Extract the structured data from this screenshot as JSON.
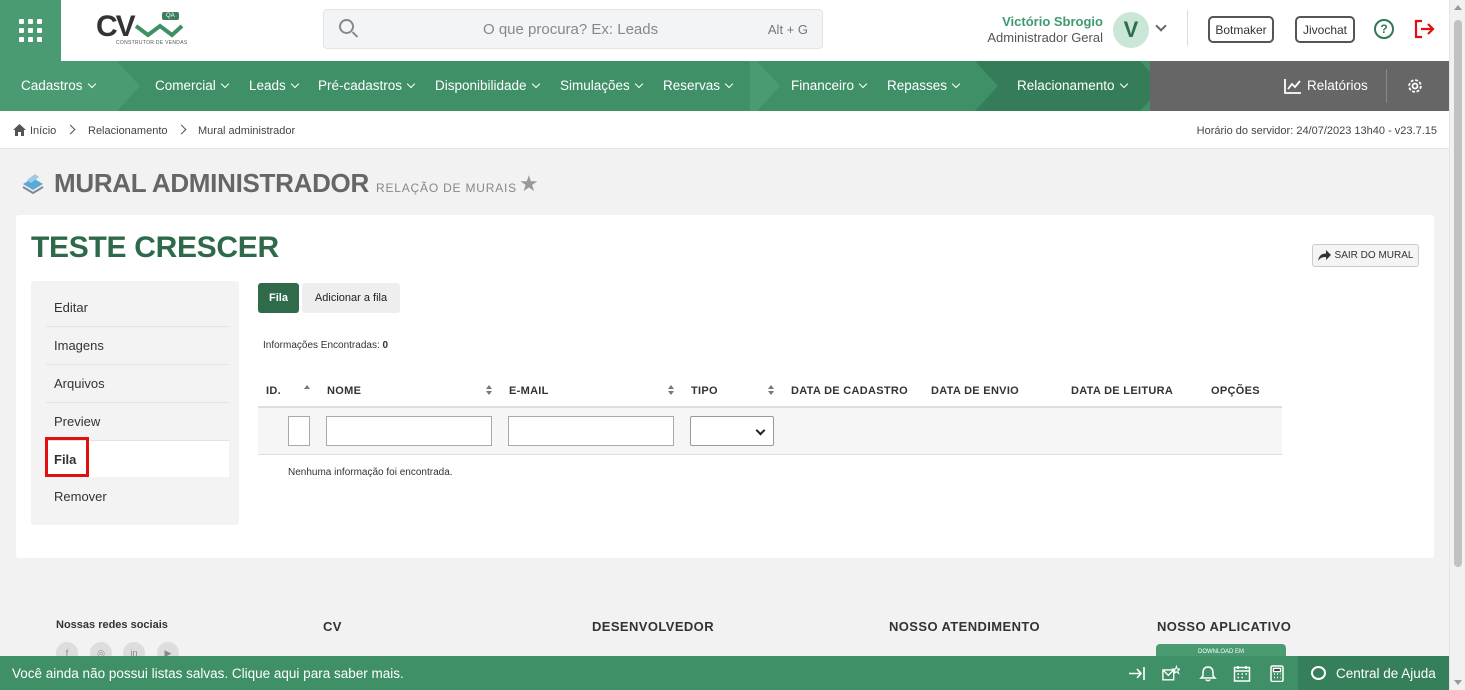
{
  "header": {
    "logo_text": "CV",
    "logo_badge": "QA",
    "logo_sub": "CONSTRUTOR DE VENDAS",
    "search_placeholder": "O que procura? Ex: Leads",
    "search_shortcut": "Alt + G",
    "user_name": "Victório Sbrogio",
    "user_role": "Administrador Geral",
    "avatar_letter": "V",
    "botmaker_label": "Botmaker",
    "jivochat_label": "Jivochat",
    "help_glyph": "?"
  },
  "nav": {
    "items": [
      "Cadastros",
      "Comercial",
      "Leads",
      "Pré-cadastros",
      "Disponibilidade",
      "Simulações",
      "Reservas",
      "Financeiro",
      "Repasses",
      "Relacionamento"
    ],
    "reports_label": "Relatórios"
  },
  "breadcrumb": {
    "items": [
      "Início",
      "Relacionamento",
      "Mural administrador"
    ],
    "server_time": "Horário do servidor: 24/07/2023 13h40 - v23.7.15"
  },
  "page": {
    "title": "MURAL ADMINISTRADOR",
    "subtitle": "RELAÇÃO DE MURAIS",
    "star": "★"
  },
  "mural": {
    "name": "TESTE CRESCER",
    "exit_label": "SAIR DO MURAL",
    "menu": [
      "Editar",
      "Imagens",
      "Arquivos",
      "Preview",
      "Fila",
      "Remover"
    ],
    "active_menu": "Fila",
    "tabs": [
      "Fila",
      "Adicionar a fila"
    ],
    "found_label": "Informações Encontradas:",
    "found_count": "0",
    "columns": [
      "ID.",
      "NOME",
      "E-MAIL",
      "TIPO",
      "DATA DE CADASTRO",
      "DATA DE ENVIO",
      "DATA DE LEITURA",
      "OPÇÕES"
    ],
    "empty_message": "Nenhuma informação foi encontrada."
  },
  "footer": {
    "social_title": "Nossas redes sociais",
    "social_icons": [
      "f",
      "◎",
      "in",
      "▶"
    ],
    "headings": [
      "CV",
      "DESENVOLVEDOR",
      "NOSSO ATENDIMENTO",
      "NOSSO APLICATIVO"
    ],
    "download_label": "DOWNLOAD EM"
  },
  "bottom_bar": {
    "message": "Você ainda não possui listas salvas. Clique aqui para saber mais.",
    "help_center": "Central de Ajuda"
  },
  "colors": {
    "brand_green": "#3f8f67",
    "dark_green": "#2e6a4a",
    "highlight_red": "#e01010"
  }
}
